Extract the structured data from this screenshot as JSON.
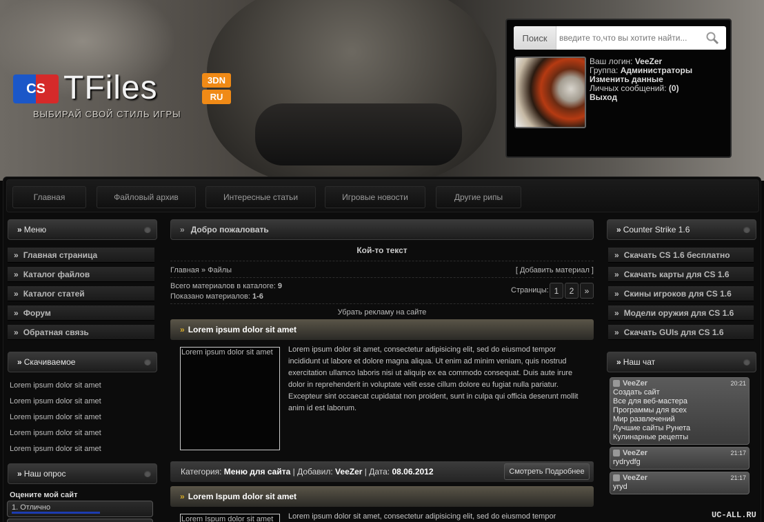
{
  "header": {
    "logo_mark": "CS",
    "logo_text": "TFiles",
    "badge_top": "3DN",
    "badge_bottom": "RU",
    "slogan": "ВЫБИРАЙ СВОЙ СТИЛЬ ИГРЫ"
  },
  "search": {
    "button": "Поиск",
    "placeholder": "введите то,что вы хотите найти...",
    "icon": "magnifier-icon"
  },
  "user": {
    "login_label": "Ваш логин:",
    "login": "VeeZer",
    "group_label": "Группа:",
    "group": "Администраторы",
    "edit": "Изменить данные",
    "messages_label": "Личных сообщений:",
    "messages": "(0)",
    "logout": "Выход"
  },
  "nav": [
    "Главная",
    "Файловый архив",
    "Интересные статьи",
    "Игровые новости",
    "Другие рипы"
  ],
  "left": {
    "menu_title": "Меню",
    "menu": [
      "Главная страница",
      "Каталог файлов",
      "Каталог статей",
      "Форум",
      "Обратная связь"
    ],
    "downloads_title": "Скачиваемое",
    "downloads": [
      "Lorem ipsum dolor sit amet",
      "Lorem ipsum dolor sit amet",
      "Lorem ipsum dolor sit amet",
      "Lorem ipsum dolor sit amet",
      "Lorem ipsum dolor sit amet"
    ],
    "poll_title": "Наш опрос",
    "poll_question": "Оцените мой сайт",
    "poll_option": "1. Отлично"
  },
  "main": {
    "welcome": "Добро пожаловать",
    "some_text": "Кой-то текст",
    "breadcrumb_home": "Главная",
    "breadcrumb_sep": "»",
    "breadcrumb_current": "Файлы",
    "add_material": "[ Добавить материал ]",
    "total_label": "Всего материалов в каталоге:",
    "total": "9",
    "shown_label": "Показано материалов:",
    "shown": "1-6",
    "pages_label": "Страницы:",
    "pages": [
      "1",
      "2",
      "»"
    ],
    "remove_ads": "Убрать рекламу на сайте",
    "news": [
      {
        "title": "Lorem ipsum dolor sit amet",
        "thumb": "Lorem ipsum dolor sit amet",
        "text": "Lorem ipsum dolor sit amet, consectetur adipisicing elit, sed do eiusmod tempor incididunt ut labore et dolore magna aliqua. Ut enim ad minim veniam, quis nostrud exercitation ullamco laboris nisi ut aliquip ex ea commodo consequat. Duis aute irure dolor in reprehenderit in voluptate velit esse cillum dolore eu fugiat nulla pariatur. Excepteur sint occaecat cupidatat non proident, sunt in culpa qui officia deserunt mollit anim id est laborum."
      },
      {
        "title": "Lorem Ispum dolor sit amet",
        "thumb": "Lorem Ispum dolor sit amet",
        "text": "Lorem ipsum dolor sit amet, consectetur adipisicing elit, sed do eiusmod tempor incididunt"
      }
    ],
    "footer": {
      "category_label": "Категория:",
      "category": "Меню для сайта",
      "added_label": "Добавил:",
      "author": "VeeZer",
      "date_label": "Дата:",
      "date": "08.06.2012",
      "more": "Смотреть Подробнее"
    }
  },
  "right": {
    "cs_title": "Counter Strike 1.6",
    "cs_links": [
      "Скачать CS 1.6 бесплатно",
      "Скачать карты для CS 1.6",
      "Скины игроков для CS 1.6",
      "Модели оружия для CS 1.6",
      "Скачать GUIs для CS 1.6"
    ],
    "chat_title": "Наш чат",
    "chat": [
      {
        "user": "VeeZer",
        "time": "20:21",
        "lines": [
          "Создать сайт",
          "Все для веб-мастера",
          "Программы для всех",
          "Мир развлечений",
          "Лучшие сайты Рунета",
          "Кулинарные рецепты"
        ]
      },
      {
        "user": "VeeZer",
        "time": "21:17",
        "lines": [
          "rydrydfg"
        ]
      },
      {
        "user": "VeeZer",
        "time": "21:17",
        "lines": [
          "yryd"
        ]
      }
    ]
  },
  "watermark": "UC-ALL.RU"
}
